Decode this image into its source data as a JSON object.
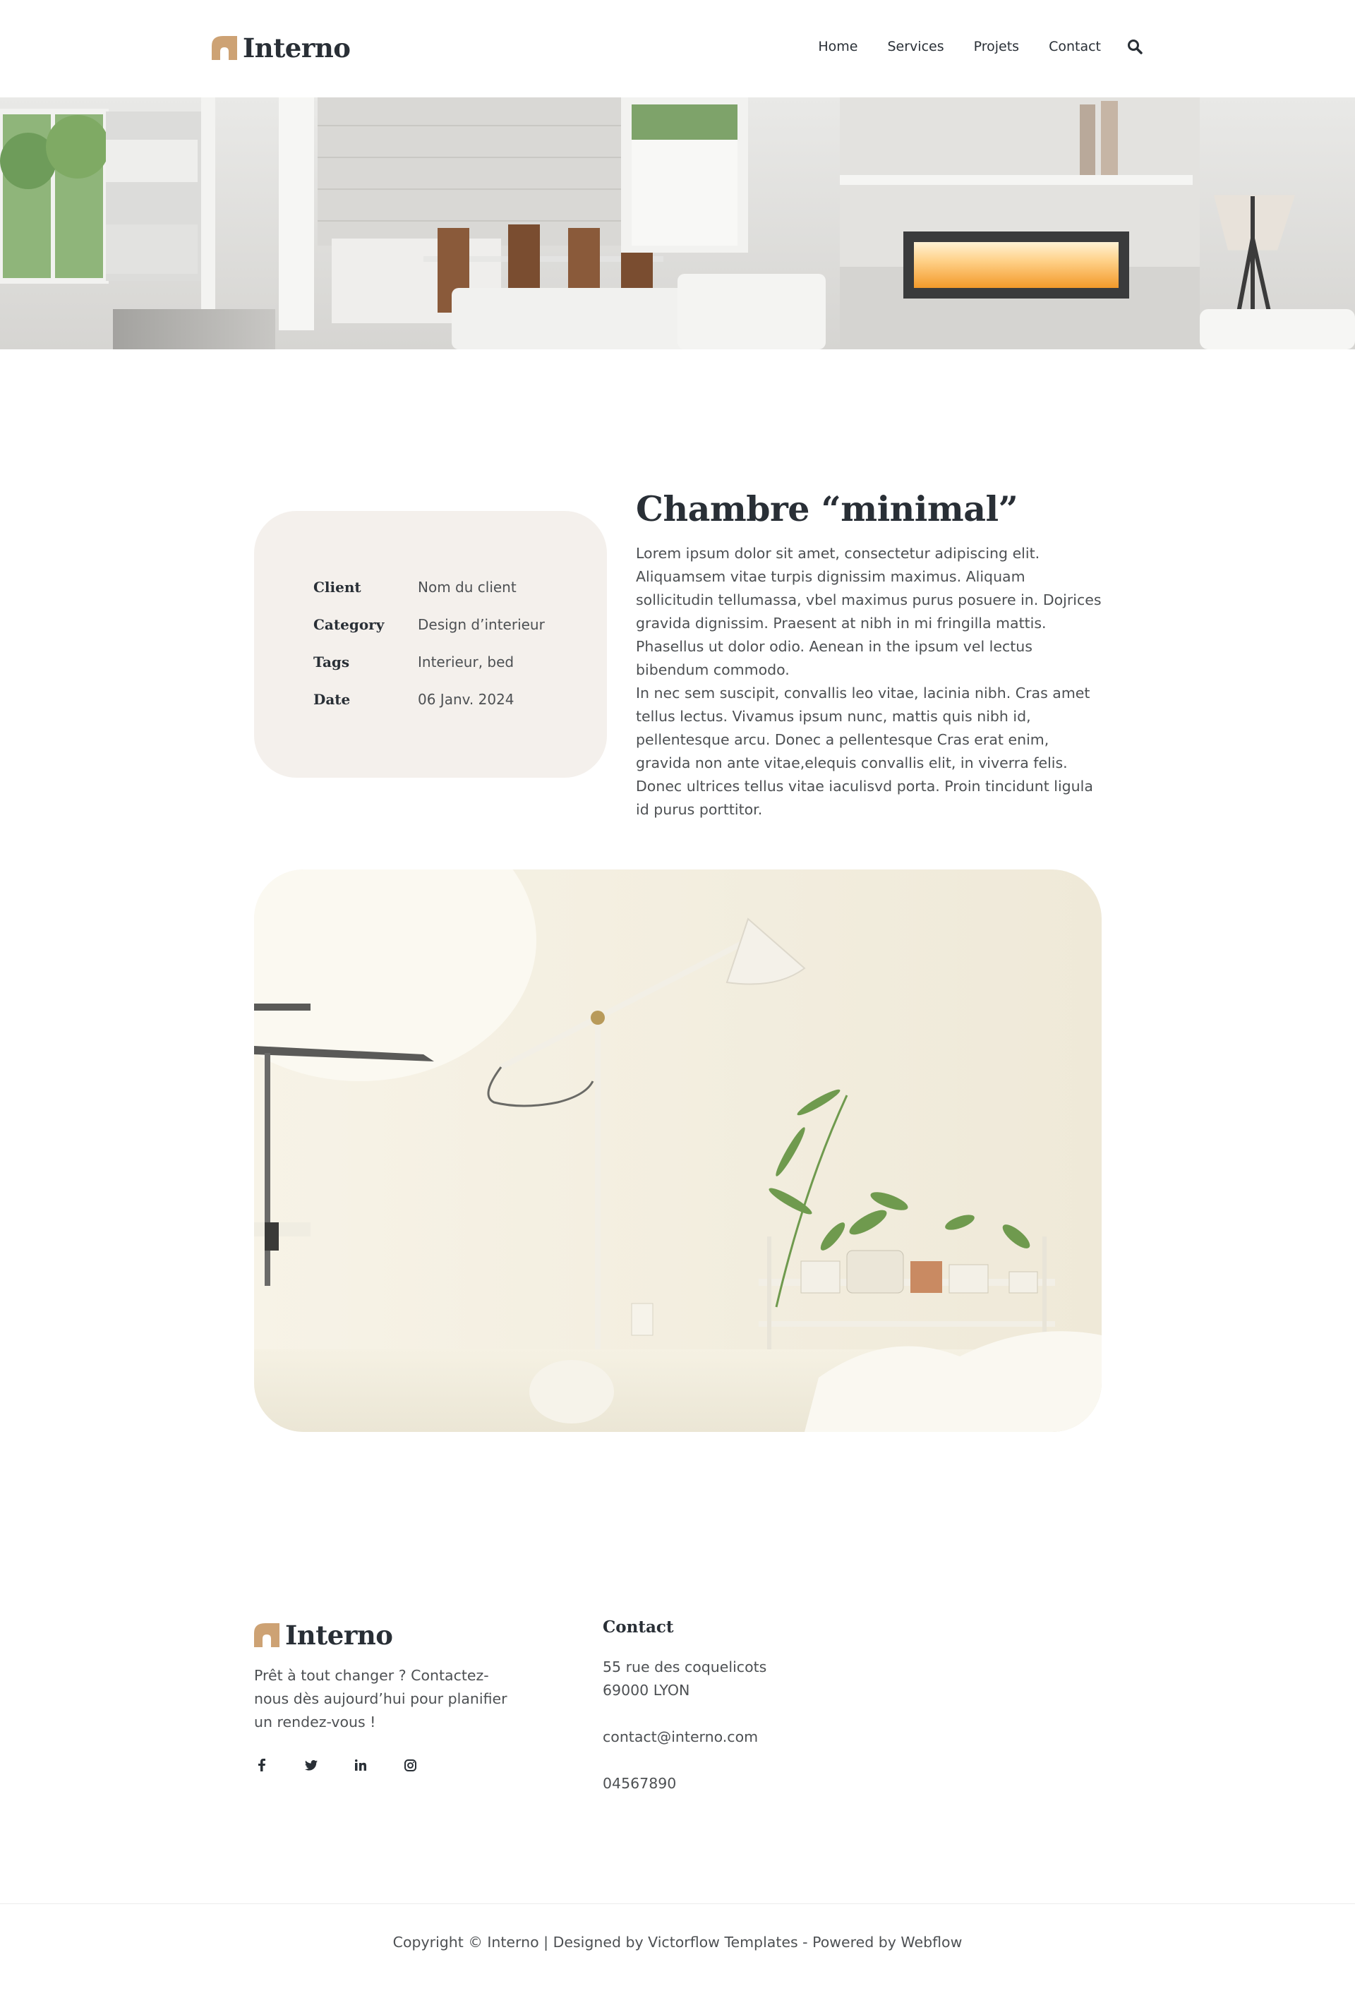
{
  "brand": {
    "name": "Interno",
    "accent": "#cda274",
    "dark": "#292f36"
  },
  "nav": {
    "items": [
      "Home",
      "Services",
      "Projets",
      "Contact"
    ],
    "search_icon": "search-icon"
  },
  "project": {
    "title": "Chambre “minimal”",
    "details": [
      {
        "label": "Client",
        "value": "Nom du client"
      },
      {
        "label": "Category",
        "value": "Design d’interieur"
      },
      {
        "label": "Tags",
        "value": "Interieur, bed"
      },
      {
        "label": "Date",
        "value": "06 Janv. 2024"
      }
    ],
    "paragraphs": [
      "Lorem ipsum dolor sit amet, consectetur adipiscing elit. Aliquamsem vitae turpis dignissim maximus. Aliquam sollicitudin tellumassa, vbel maximus purus posuere in. Dojrices gravida dignissim. Praesent at nibh in mi fringilla mattis. Phasellus ut dolor odio. Aenean in the ipsum vel lectus bibendum commodo.",
      "In nec sem suscipit, convallis leo vitae, lacinia nibh. Cras amet tellus lectus. Vivamus ipsum nunc, mattis quis nibh id, pellentesque arcu. Donec a pellentesque Cras erat enim, gravida non ante vitae,elequis convallis elit, in viverra felis. Donec ultrices tellus vitae iaculisvd porta. Proin tincidunt ligula id purus porttitor."
    ]
  },
  "footer": {
    "description": "Prêt à tout changer ? Contactez-nous dès aujourd’hui pour planifier un rendez-vous !",
    "socials": [
      "facebook-icon",
      "twitter-icon",
      "linkedin-icon",
      "instagram-icon"
    ],
    "contact_title": "Contact",
    "address_line1": "55 rue des coquelicots",
    "address_line2": "69000 LYON",
    "email": "contact@interno.com",
    "phone": "04567890",
    "copyright": "Copyright © Interno | Designed by Victorflow Templates - Powered by Webflow"
  }
}
